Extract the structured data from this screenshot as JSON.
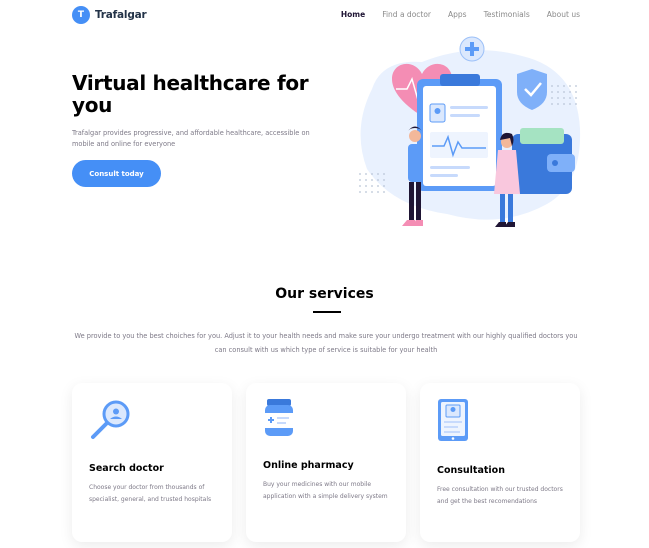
{
  "brand": {
    "initial": "T",
    "name": "Trafalgar"
  },
  "nav": {
    "items": [
      "Home",
      "Find a doctor",
      "Apps",
      "Testimonials",
      "About us"
    ]
  },
  "hero": {
    "title": "Virtual healthcare for you",
    "subtitle": "Trafalgar provides progressive, and affordable healthcare, accessible on mobile and online for everyone",
    "cta_label": "Consult today"
  },
  "services": {
    "title": "Our services",
    "subtitle": "We provide to you the best choiches for you. Adjust it to your health needs and make sure your undergo treatment with our highly qualified doctors you can consult with us which type of service is suitable for your health",
    "cards": [
      {
        "title": "Search doctor",
        "description": "Choose your doctor from thousands of specialist, general, and trusted hospitals",
        "icon": "magnifier-icon"
      },
      {
        "title": "Online pharmacy",
        "description": "Buy your medicines with our mobile application with a simple delivery system",
        "icon": "medicine-bottle-icon"
      },
      {
        "title": "Consultation",
        "description": "Free consultation with our trusted doctors and get the best recomendations",
        "icon": "tablet-profile-icon"
      }
    ]
  },
  "colors": {
    "accent": "#458ff6",
    "text_dark": "#1f1534",
    "text_muted": "#7d7987"
  }
}
